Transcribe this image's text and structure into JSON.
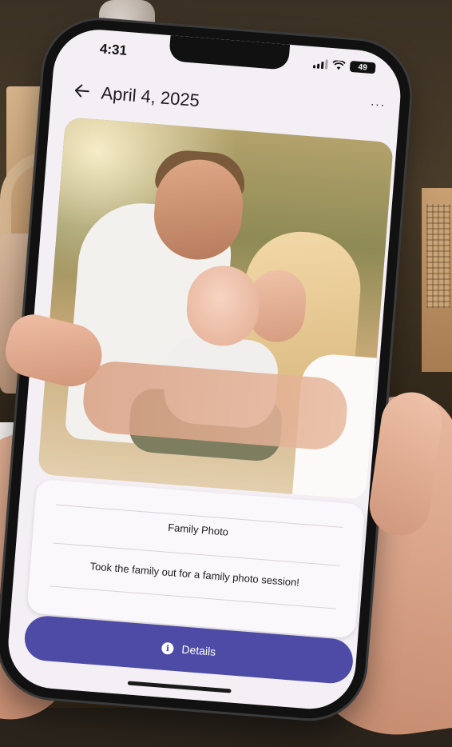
{
  "status_bar": {
    "time": "4:31",
    "battery": "49",
    "icons": [
      "signal-icon",
      "wifi-icon",
      "battery-icon"
    ]
  },
  "app_bar": {
    "back_icon": "arrow-left-icon",
    "title": "April 4, 2025",
    "more_icon": "more-horizontal-icon",
    "more_label": "···"
  },
  "photo": {
    "subject": "family photo: father, mother and baby"
  },
  "card": {
    "title": "Family Photo",
    "description": "Took the family out for a family photo session!"
  },
  "details_button": {
    "icon": "info-icon",
    "icon_glyph": "i",
    "label": "Details"
  },
  "colors": {
    "accent": "#4e4ba6",
    "screen_bg": "#f4eff4",
    "card_bg": "#fbf8fb"
  }
}
